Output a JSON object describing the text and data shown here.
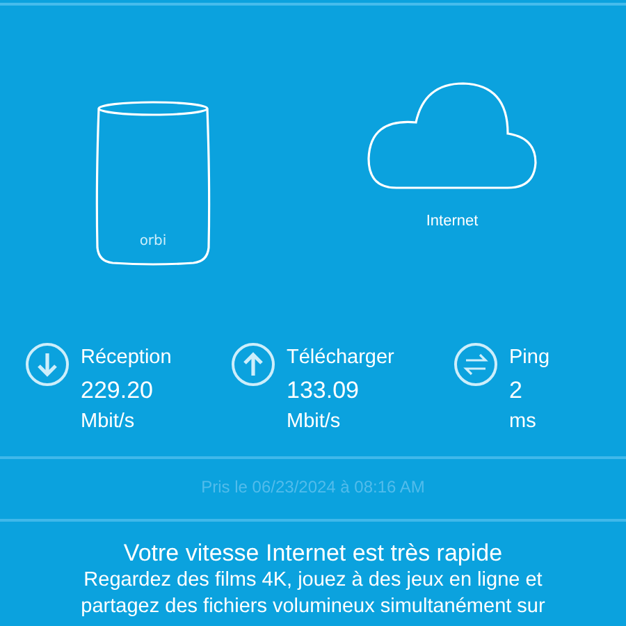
{
  "devices": [
    {
      "kind": "router",
      "logo": "orbi"
    },
    {
      "kind": "cloud",
      "label": "Internet"
    }
  ],
  "stats": [
    {
      "kind": "download",
      "label": "Réception",
      "value": "229.20",
      "unit": "Mbit/s"
    },
    {
      "kind": "upload",
      "label": "Télécharger",
      "value": "133.09",
      "unit": "Mbit/s"
    },
    {
      "kind": "ping",
      "label": "Ping",
      "value": "2",
      "unit": "ms"
    }
  ],
  "timestamp": "Pris le 06/23/2024 à 08:16 AM",
  "result": {
    "title": "Votre vitesse Internet est très rapide",
    "description_lines": [
      "Regardez des films 4K, jouez à des jeux en ligne et",
      "partagez des fichiers volumineux simultanément sur"
    ]
  }
}
